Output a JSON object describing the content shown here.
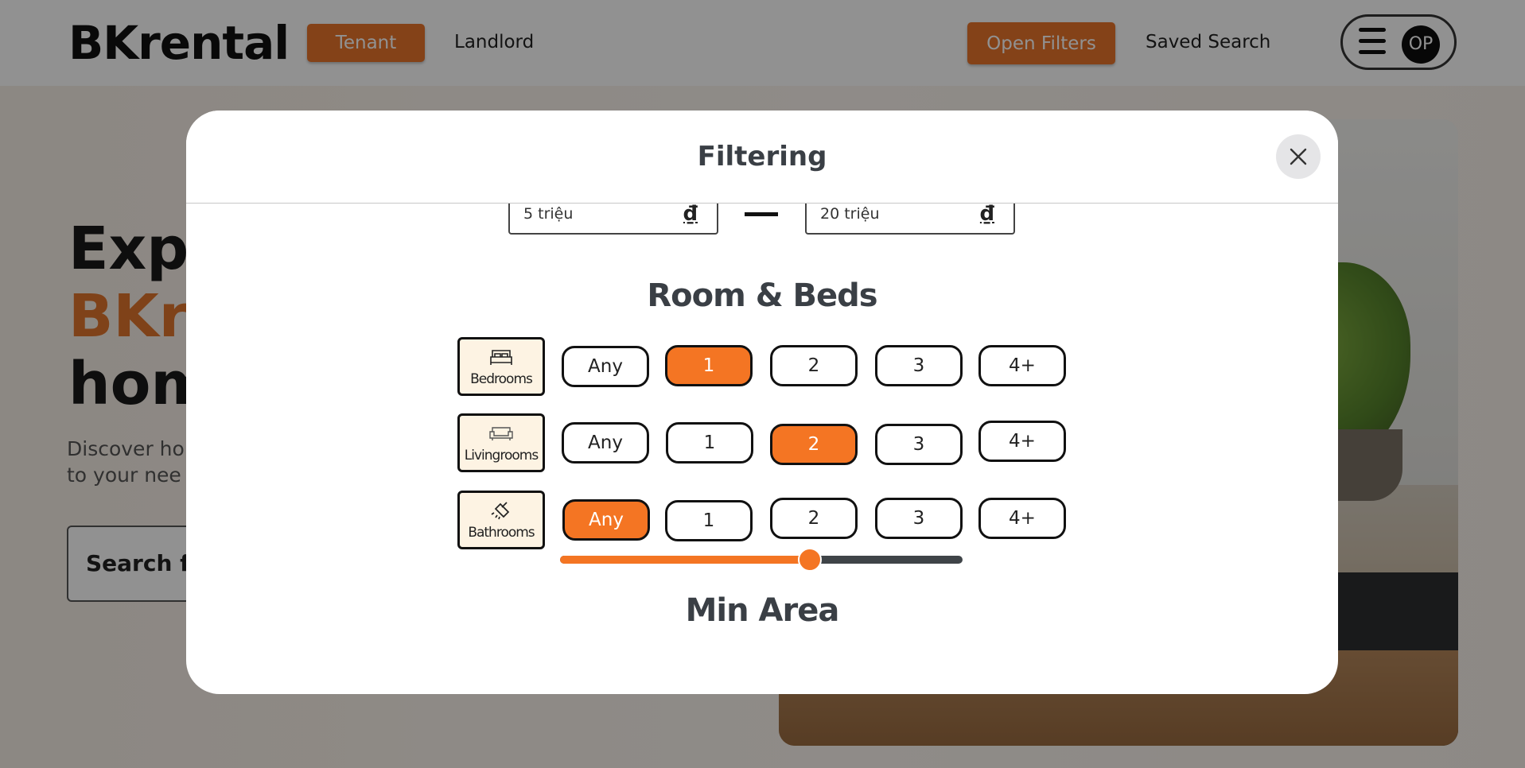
{
  "app": {
    "logo": "BKrental"
  },
  "nav": {
    "tenant": "Tenant",
    "landlord": "Landlord",
    "open_filters": "Open Filters",
    "saved_search": "Saved Search",
    "avatar_initials": "OP"
  },
  "hero": {
    "line1": "Expe",
    "line2": "BKre",
    "line3": "hom",
    "sub1": "Discover ho",
    "sub2": "to your nee",
    "search_text": "Search fo"
  },
  "modal": {
    "title": "Filtering",
    "price": {
      "min": "5 triệu",
      "max": "20 triệu",
      "currency": "₫"
    },
    "rooms_title": "Room & Beds",
    "rows": [
      {
        "label": "Bedrooms",
        "icon": "bed-icon",
        "options": [
          "Any",
          "1",
          "2",
          "3",
          "4+"
        ],
        "selected": "1"
      },
      {
        "label": "Livingrooms",
        "icon": "sofa-icon",
        "options": [
          "Any",
          "1",
          "2",
          "3",
          "4+"
        ],
        "selected": "2"
      },
      {
        "label": "Bathrooms",
        "icon": "shower-icon",
        "options": [
          "Any",
          "1",
          "2",
          "3",
          "4+"
        ],
        "selected": "Any"
      }
    ],
    "area_title": "Min Area",
    "area_slider_fraction": 0.62
  },
  "colors": {
    "accent": "#f47523",
    "nav_accent": "#e8742b",
    "title_text": "#3a3f45"
  }
}
